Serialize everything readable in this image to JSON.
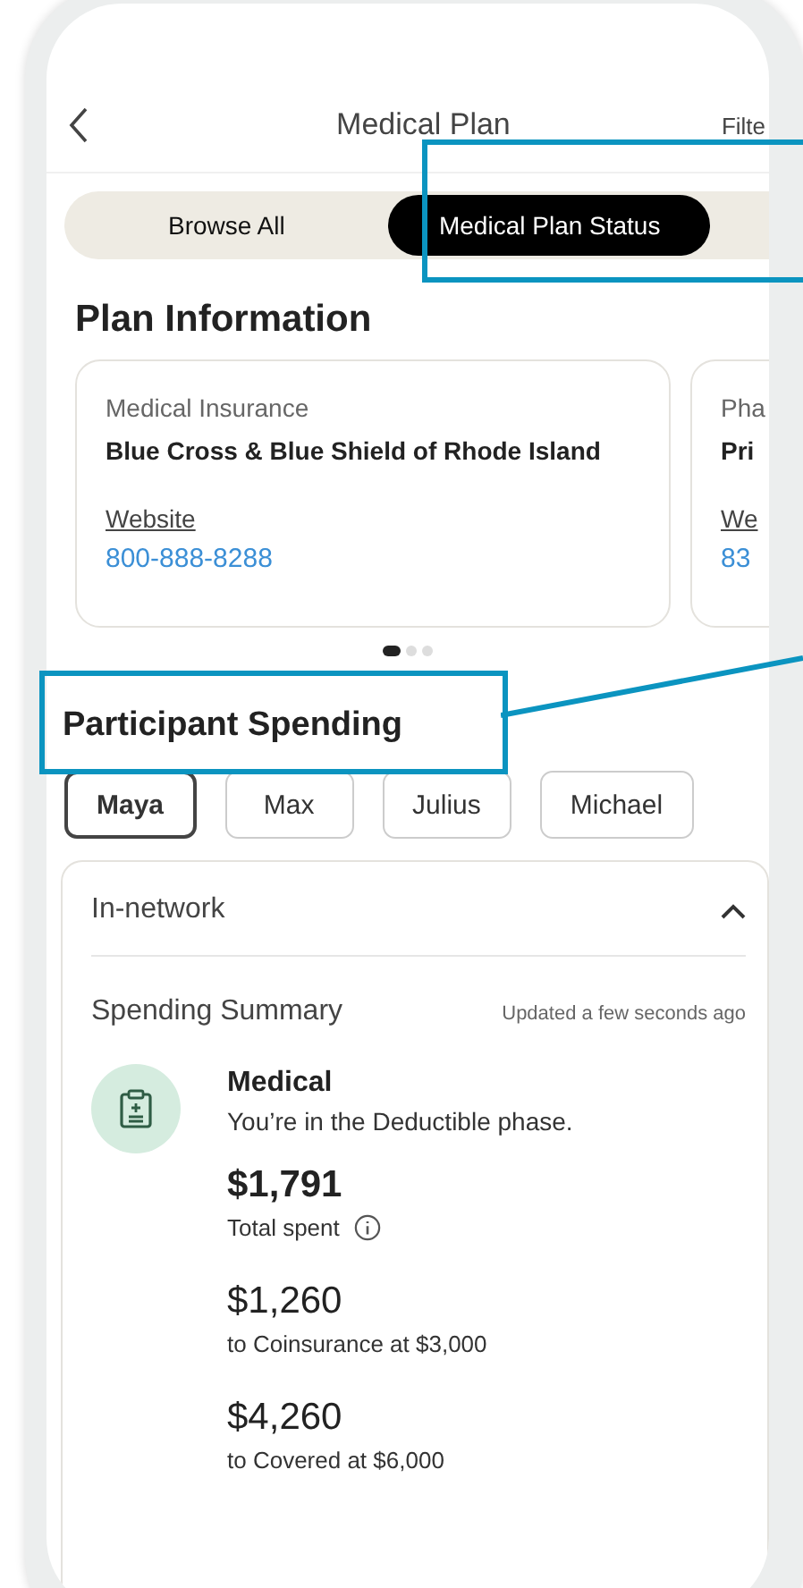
{
  "header": {
    "title": "Medical Plan",
    "action": "Filte"
  },
  "tabs": [
    {
      "label": "Browse All",
      "selected": false
    },
    {
      "label": "Medical Plan Status",
      "selected": true
    }
  ],
  "plan_information": {
    "title": "Plan Information",
    "cards": [
      {
        "label": "Medical Insurance",
        "name": "Blue Cross & Blue Shield of Rhode Island",
        "link": "Website",
        "phone": "800-888-8288"
      },
      {
        "label": "Pha",
        "name": "Pri",
        "link": "We",
        "phone": "83"
      }
    ],
    "pager": [
      {
        "selected": true
      },
      {
        "selected": false
      },
      {
        "selected": false
      }
    ]
  },
  "participant_spending": {
    "title": "Participant Spending",
    "participants": [
      {
        "label": "Maya",
        "selected": true
      },
      {
        "label": "Max",
        "selected": false
      },
      {
        "label": "Julius",
        "selected": false
      },
      {
        "label": "Michael",
        "selected": false
      }
    ],
    "section": {
      "title": "In-network",
      "expanded": true,
      "summary_title": "Spending Summary",
      "updated": "Updated a few seconds ago",
      "category": {
        "title": "Medical",
        "phase": "You’re in the Deductible phase."
      },
      "amounts": [
        {
          "value": "$1,791",
          "caption": "Total spent",
          "kind": "total"
        },
        {
          "value": "$1,260",
          "caption": "to Coinsurance at $3,000",
          "kind": "step"
        },
        {
          "value": "$4,260",
          "caption": "to Covered at $6,000",
          "kind": "step"
        }
      ]
    }
  }
}
